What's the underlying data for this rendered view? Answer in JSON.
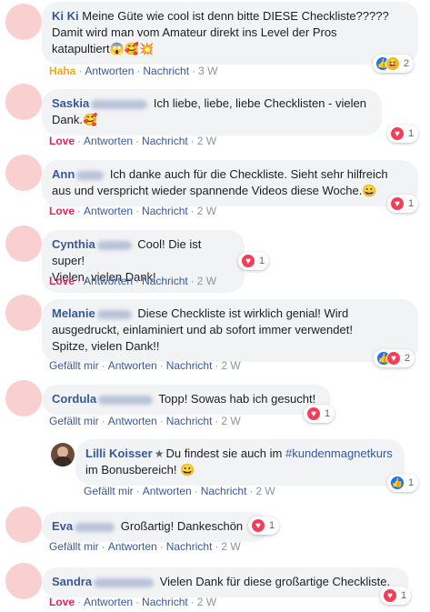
{
  "actions": {
    "like": "Gefällt mir",
    "reply": "Antworten",
    "message": "Nachricht"
  },
  "comments": [
    {
      "author": "Ki Ki",
      "text_lines": [
        "Meine Güte wie cool ist denn bitte DIESE Checkliste?????",
        "Damit wird man vom Amateur direkt ins Level der Pros",
        "katapultiert"
      ],
      "emoji": "😱🥰💥",
      "reaction_label": "Haha",
      "time": "3 W",
      "reaction_icons": [
        "like-icon",
        "haha-icon"
      ],
      "reaction_count": "2"
    },
    {
      "author": "Saskia",
      "text_lines": [
        "Ich liebe, liebe, liebe Checklisten - vielen",
        "Dank."
      ],
      "emoji": "🥰",
      "reaction_label": "Love",
      "time": "2 W",
      "reaction_icons": [
        "love-icon"
      ],
      "reaction_count": "1"
    },
    {
      "author": "Ann",
      "text_lines": [
        "Ich danke auch für die Checkliste. Sieht sehr hilfreich",
        "aus und verspricht wieder spannende Videos diese Woche."
      ],
      "emoji": "😀",
      "reaction_label": "Love",
      "time": "2 W",
      "reaction_icons": [
        "love-icon"
      ],
      "reaction_count": "1"
    },
    {
      "author": "Cynthia",
      "text_lines": [
        "Cool! Die ist super!",
        "Vielen, vielen Dank!"
      ],
      "reaction_label": "Love",
      "time": "2 W",
      "reaction_icons": [
        "love-icon"
      ],
      "reaction_count": "1"
    },
    {
      "author": "Melanie",
      "text_lines": [
        "Diese Checkliste ist wirklich genial! Wird",
        "ausgedruckt, einlaminiert und ab sofort immer verwendet!",
        "Spitze, vielen Dank!!"
      ],
      "reaction_label": "Gefällt mir",
      "time": "2 W",
      "reaction_icons": [
        "like-icon",
        "love-icon"
      ],
      "reaction_count": "2"
    },
    {
      "author": "Cordula",
      "text_lines": [
        "Topp! Sowas hab ich gesucht!"
      ],
      "reaction_label": "Gefällt mir",
      "time": "2 W",
      "reaction_icons": [
        "love-icon"
      ],
      "reaction_count": "1"
    },
    {
      "author": "Lilli Koisser",
      "text_lines": [
        "Du findest sie auch im",
        "im Bonusbereich!"
      ],
      "hashtag": "#kundenmagnetkurs",
      "emoji": "😀",
      "reaction_label": "Gefällt mir",
      "time": "2 W",
      "reaction_icons": [
        "like-icon"
      ],
      "reaction_count": "1"
    },
    {
      "author": "Eva",
      "text_lines": [
        "Großartig! Dankeschön"
      ],
      "reaction_label": "Gefällt mir",
      "time": "2 W",
      "reaction_icons": [
        "love-icon"
      ],
      "reaction_count": "1"
    },
    {
      "author": "Sandra",
      "text_lines": [
        "Vielen Dank für diese großartige Checkliste."
      ],
      "reaction_label": "Love",
      "time": "2 W",
      "reaction_icons": [
        "love-icon"
      ],
      "reaction_count": "1"
    }
  ],
  "colors": {
    "author": "#385898",
    "love": "#e0245e",
    "haha": "#f0a91d",
    "bubble": "#f2f3f5",
    "avatar": "#f9cfd0"
  }
}
